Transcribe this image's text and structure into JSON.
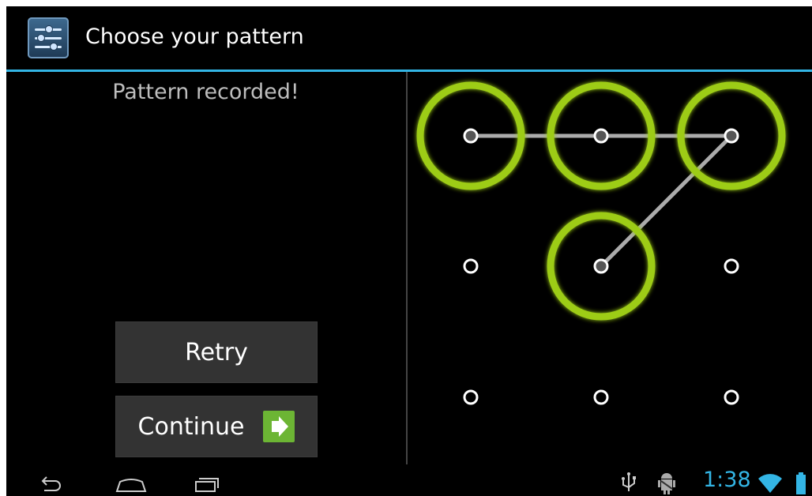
{
  "actionbar": {
    "title": "Choose your pattern",
    "app_icon": "settings-sliders-icon"
  },
  "status_text": "Pattern recorded!",
  "buttons": {
    "retry": "Retry",
    "continue": "Continue"
  },
  "pattern": {
    "selected_sequence": [
      1,
      2,
      3,
      5
    ],
    "accent_color": "#9dcc17",
    "line_color": "#c9c9c9"
  },
  "navbar": {
    "back_icon": "back-icon",
    "home_icon": "home-icon",
    "recents_icon": "recent-apps-icon"
  },
  "statusbar": {
    "time": "1:38",
    "usb_icon": "usb-icon",
    "debug_icon": "android-debug-icon",
    "wifi_icon": "wifi-icon",
    "battery_icon": "battery-icon"
  },
  "colors": {
    "holo_blue": "#33b5e5",
    "button_bg": "#333333",
    "continue_arrow_bg": "#6cb534"
  }
}
